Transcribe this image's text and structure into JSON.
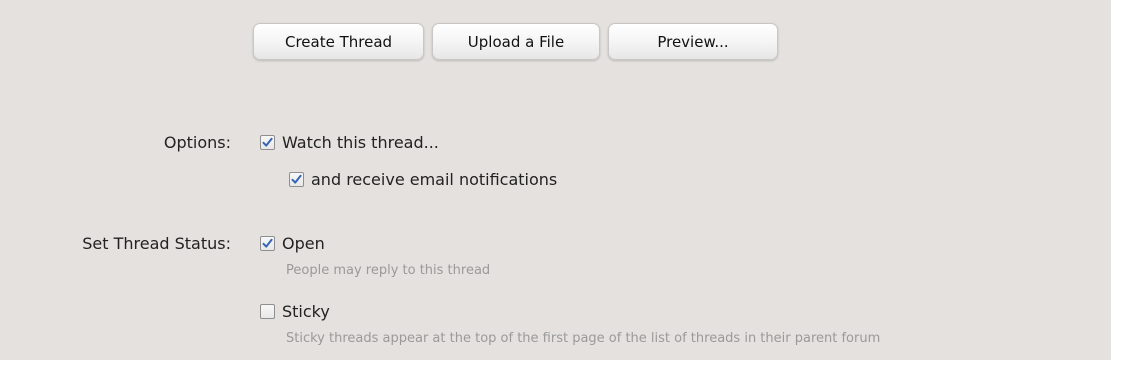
{
  "buttons": {
    "create_thread": "Create Thread",
    "upload_file": "Upload a File",
    "preview": "Preview..."
  },
  "options": {
    "label": "Options:",
    "watch_thread": {
      "label": "Watch this thread...",
      "checked": true
    },
    "email_notifications": {
      "label": "and receive email notifications",
      "checked": true
    }
  },
  "status": {
    "label": "Set Thread Status:",
    "open": {
      "label": "Open",
      "checked": true,
      "hint": "People may reply to this thread"
    },
    "sticky": {
      "label": "Sticky",
      "checked": false,
      "hint": "Sticky threads appear at the top of the first page of the list of threads in their parent forum"
    }
  },
  "colors": {
    "panel_background": "#e4e1de",
    "check_color": "#3565b8",
    "hint_color": "#9a9a9a"
  }
}
